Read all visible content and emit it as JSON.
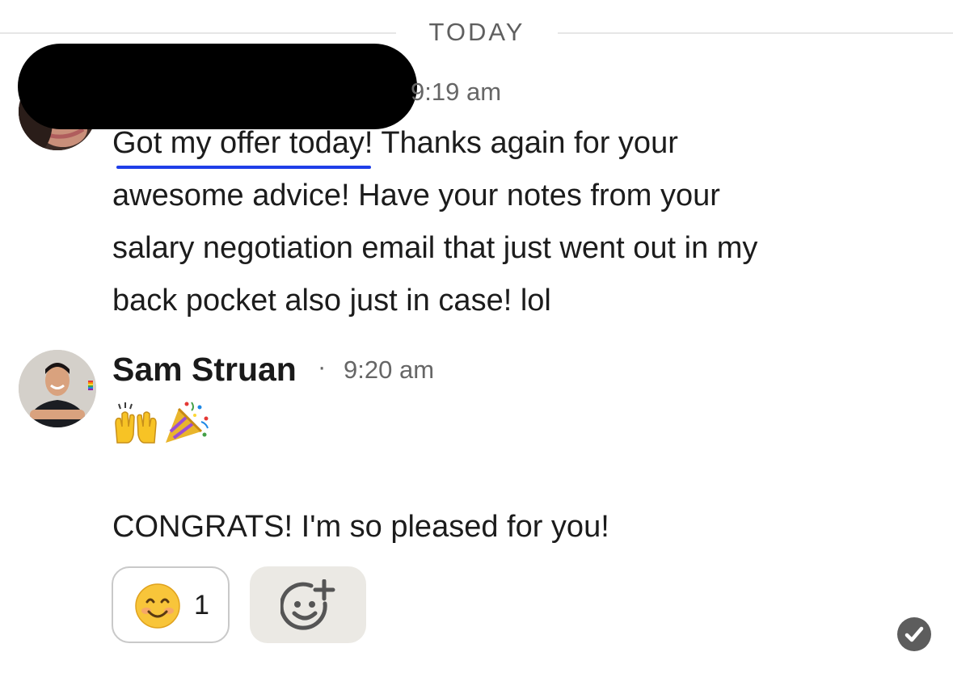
{
  "divider": {
    "label": "TODAY"
  },
  "messages": [
    {
      "sender": "",
      "time": "9:19 am",
      "lines": [
        {
          "underlined": "Got my offer today",
          "rest": "! Thanks again for your"
        },
        "awesome advice! Have your notes from your",
        "salary negotiation email that just went out in my",
        "back pocket also just in case! lol"
      ]
    },
    {
      "sender": "Sam Struan",
      "separator": "·",
      "time": "9:20 am",
      "emojis": [
        "raising-hands-icon",
        "party-popper-icon"
      ],
      "text": "CONGRATS! I'm so pleased for you!",
      "reactions": [
        {
          "emoji": "smiling-face-icon",
          "count": "1"
        }
      ]
    }
  ],
  "status": {
    "icon": "read-check-icon"
  },
  "colors": {
    "link_underline": "#1f3ee8",
    "divider": "#e6e6e6",
    "add_reaction_bg": "#ebe9e4"
  }
}
